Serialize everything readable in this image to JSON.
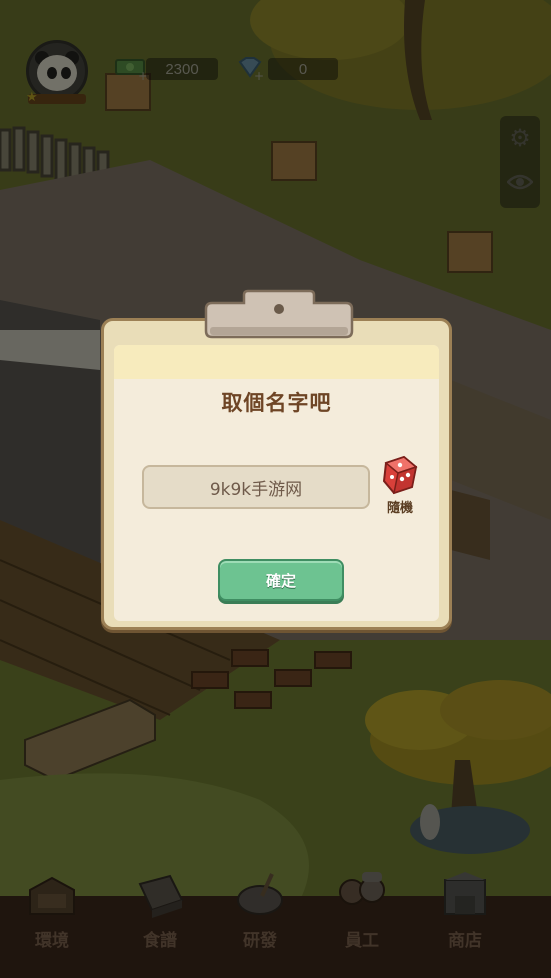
{
  "hud": {
    "cash": "2300",
    "gems": "0",
    "cash_icon": "cash-icon",
    "gem_icon": "diamond-icon",
    "settings_icon": "gear-icon",
    "view_icon": "eye-icon"
  },
  "dialog": {
    "title": "取個名字吧",
    "name_value": "9k9k手游网",
    "random_label": "隨機",
    "random_icon": "dice-icon",
    "confirm_label": "確定"
  },
  "nav": {
    "items": [
      {
        "label": "環境",
        "icon": "environment-icon"
      },
      {
        "label": "食譜",
        "icon": "recipe-book-icon"
      },
      {
        "label": "研發",
        "icon": "cooking-pot-icon"
      },
      {
        "label": "員工",
        "icon": "staff-icon"
      },
      {
        "label": "商店",
        "icon": "shop-icon"
      }
    ]
  },
  "colors": {
    "confirm_green": "#6dc391",
    "title_brown": "#6e4525",
    "board_tan": "#e9ddb8",
    "dice_red": "#d9403a"
  }
}
